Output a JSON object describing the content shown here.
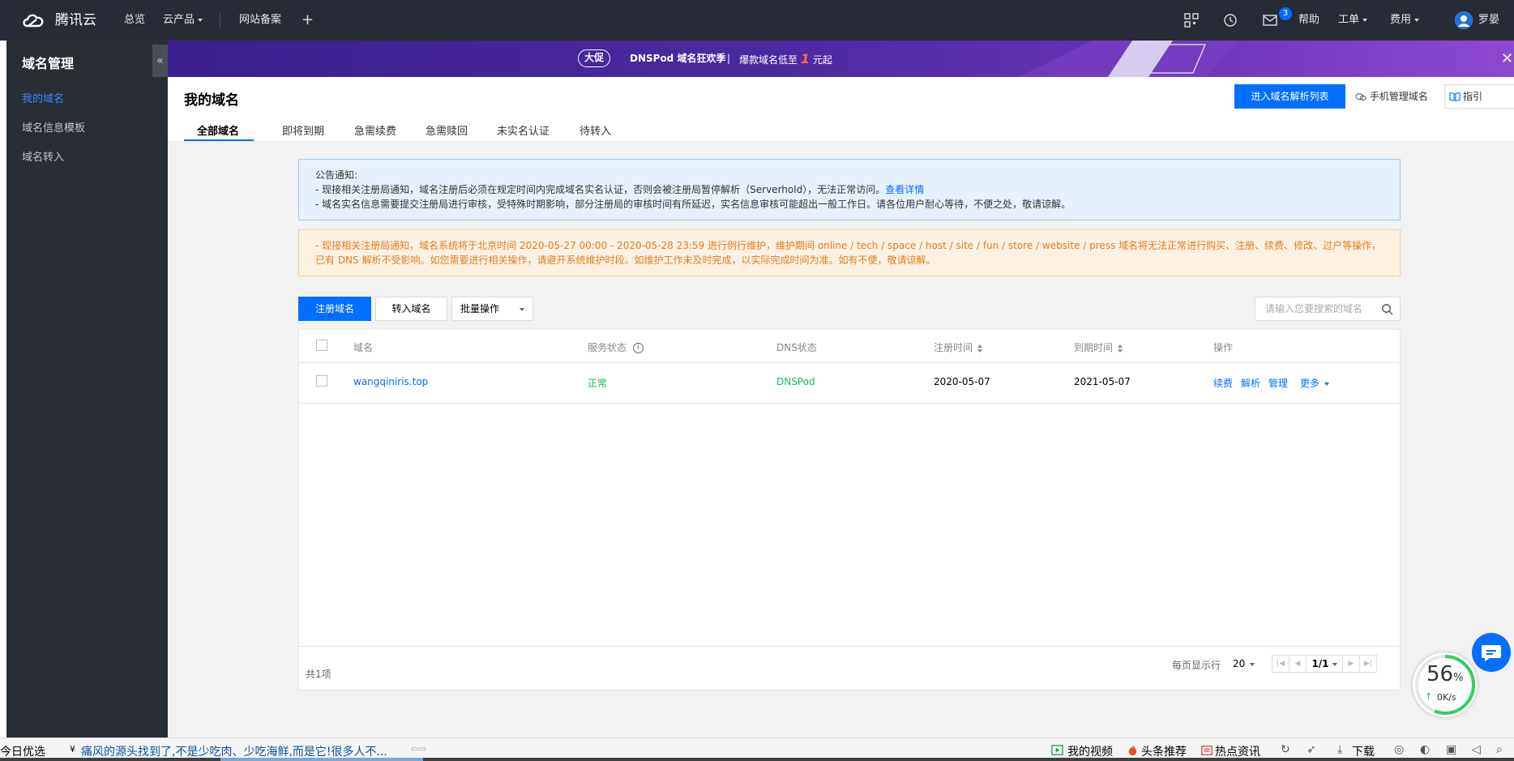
{
  "topnav": {
    "brand": "腾讯云",
    "overview": "总览",
    "products": "云产品",
    "filing": "网站备案",
    "plus": "+",
    "mail_badge": "3",
    "help": "帮助",
    "ticket": "工单",
    "billing": "费用",
    "user": "罗晏"
  },
  "sidebar": {
    "title": "域名管理",
    "collapse": "«",
    "items": [
      {
        "label": "我的域名"
      },
      {
        "label": "域名信息模板"
      },
      {
        "label": "域名转入"
      }
    ]
  },
  "banner": {
    "tag": "大促",
    "text": "DNSPod 域名狂欢季",
    "divider": "|",
    "promo_prefix": "爆款域名低至",
    "promo_num": "1",
    "promo_suffix": "元起",
    "close": "✕"
  },
  "header": {
    "title": "我的域名",
    "primary_button": "进入域名解析列表",
    "mobile_link": "手机管理域名",
    "guide_button": "指引",
    "tabs": [
      {
        "label": "全部域名"
      },
      {
        "label": "即将到期"
      },
      {
        "label": "急需续费"
      },
      {
        "label": "急需赎回"
      },
      {
        "label": "未实名认证"
      },
      {
        "label": "待转入"
      }
    ]
  },
  "notice1": {
    "title": "公告通知:",
    "line1": "- 现接相关注册局通知，域名注册后必须在规定时间内完成域名实名认证，否则会被注册局暂停解析（Serverhold），无法正常访问。",
    "line1_link": "查看详情",
    "line2": "- 域名实名信息需要提交注册局进行审核，受特殊时期影响，部分注册局的审核时间有所延迟，实名信息审核可能超出一般工作日。请各位用户耐心等待，不便之处，敬请谅解。"
  },
  "notice2": {
    "text": "- 现接相关注册局通知，域名系统将于北京时间 2020-05-27 00:00 - 2020-05-28 23:59 进行例行维护，维护期间 online / tech / space / host / site / fun / store / website / press 域名将无法正常进行购买、注册、续费、修改、过户等操作，已有 DNS 解析不受影响。如您需要进行相关操作，请避开系统维护时段。如维护工作未及时完成，以实际完成时间为准。如有不便，敬请谅解。"
  },
  "toolbar": {
    "register": "注册域名",
    "transfer": "转入域名",
    "batch": "批量操作",
    "search_placeholder": "请输入您要搜索的域名"
  },
  "table": {
    "columns": [
      "域名",
      "服务状态",
      "DNS状态",
      "注册时间",
      "到期时间",
      "操作"
    ],
    "rows": [
      {
        "domain": "wangqiniris.top",
        "status": "正常",
        "dns": "DNSPod",
        "registered": "2020-05-07",
        "expires": "2021-05-07",
        "actions": [
          "续费",
          "解析",
          "管理",
          "更多"
        ]
      }
    ],
    "total": "共1项",
    "per_page_label": "每页显示行",
    "per_page": "20",
    "page": "1/1"
  },
  "speed": {
    "percent": "56",
    "percent_unit": "%",
    "rate": "0K/s"
  },
  "taskbar": {
    "start": "今日优选",
    "news": "痛风的源头找到了,不是少吃肉、少吃海鲜,而是它!很多人不...",
    "video": "我的视频",
    "headlines": "头条推荐",
    "hot": "热点资讯",
    "download": "下载"
  },
  "colors": {
    "accent": "#006eff",
    "topnav_bg": "#262b36",
    "sidebar_bg": "#292d34",
    "success": "#0abf5b",
    "warning_text": "#e27d1c"
  }
}
